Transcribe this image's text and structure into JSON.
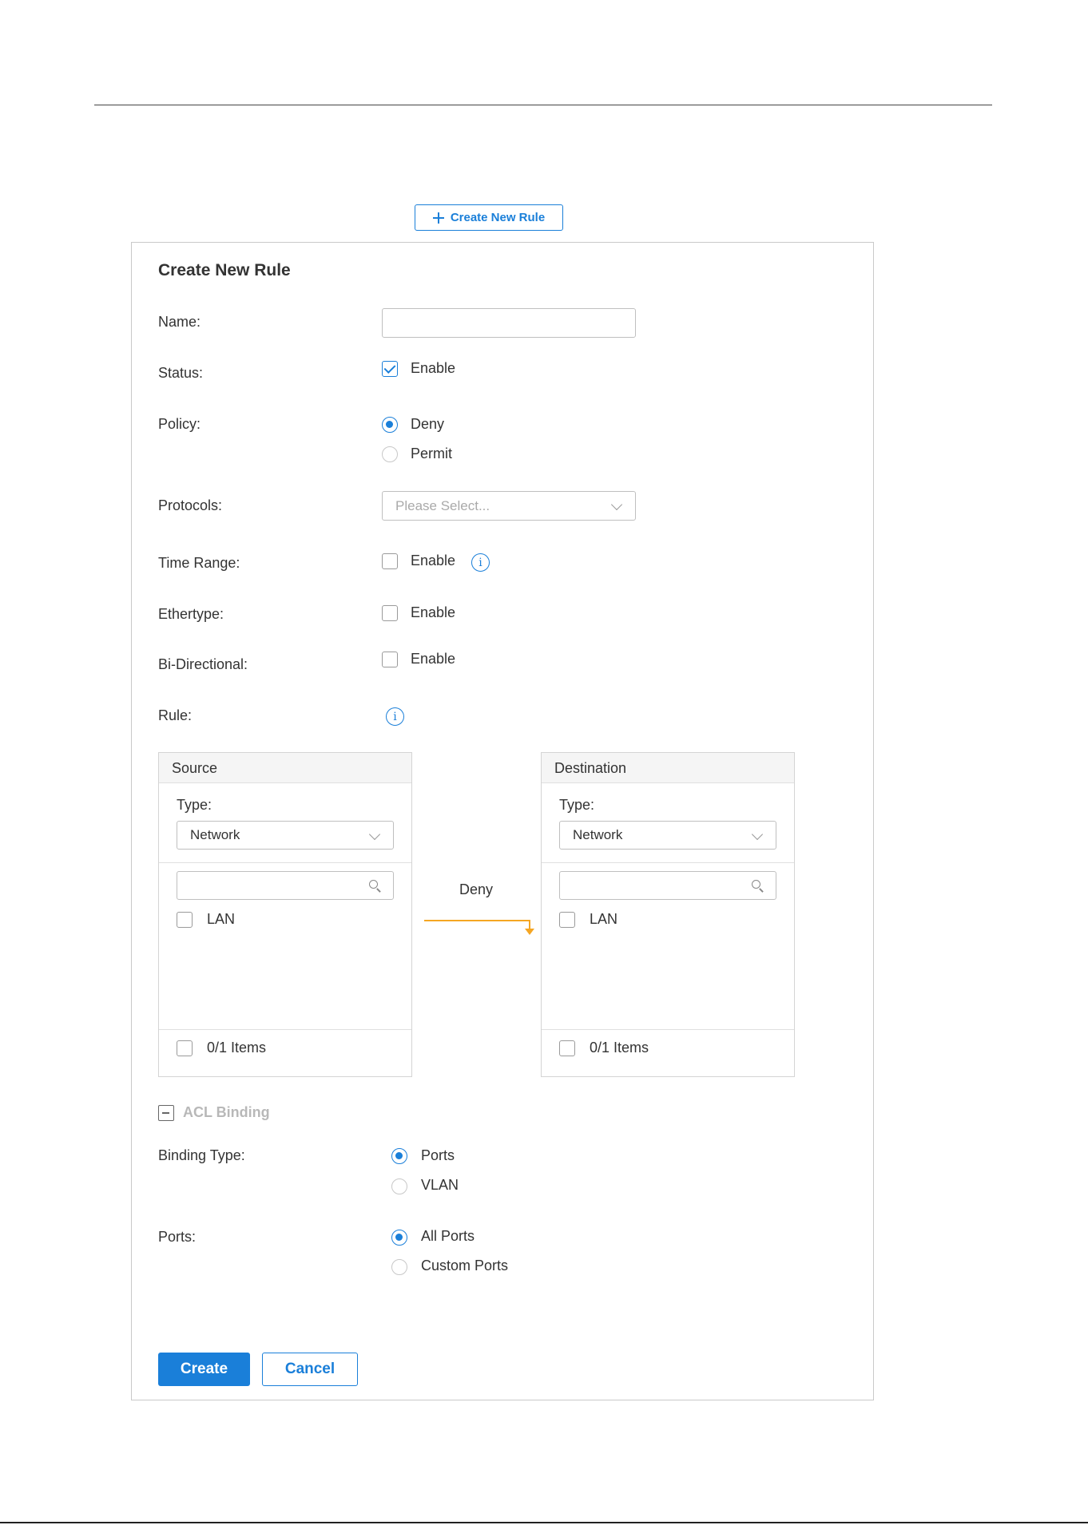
{
  "toolbar": {
    "create_new_rule_label": "Create New Rule"
  },
  "form": {
    "title": "Create New Rule",
    "name": {
      "label": "Name",
      "value": ""
    },
    "status": {
      "label": "Status",
      "option": "Enable",
      "checked": true
    },
    "policy": {
      "label": "Policy",
      "options": [
        "Deny",
        "Permit"
      ],
      "selected": "Deny"
    },
    "protocols": {
      "label": "Protocols",
      "placeholder": "Please Select..."
    },
    "time_range": {
      "label": "Time Range",
      "option": "Enable",
      "checked": false
    },
    "ethertype": {
      "label": "Ethertype",
      "option": "Enable",
      "checked": false
    },
    "bi_directional": {
      "label": "Bi-Directional",
      "option": "Enable",
      "checked": false
    },
    "rule": {
      "label": "Rule"
    }
  },
  "rule_transfer": {
    "source": {
      "title": "Source",
      "type_label": "Type",
      "type_value": "Network",
      "items": [
        {
          "label": "LAN",
          "checked": false
        }
      ],
      "footer": "0/1 Items"
    },
    "action": "Deny",
    "destination": {
      "title": "Destination",
      "type_label": "Type",
      "type_value": "Network",
      "items": [
        {
          "label": "LAN",
          "checked": false
        }
      ],
      "footer": "0/1 Items"
    }
  },
  "acl_binding": {
    "title": "ACL Binding",
    "binding_type": {
      "label": "Binding Type",
      "options": [
        "Ports",
        "VLAN"
      ],
      "selected": "Ports"
    },
    "ports": {
      "label": "Ports",
      "options": [
        "All Ports",
        "Custom Ports"
      ],
      "selected": "All Ports"
    }
  },
  "actions": {
    "create": "Create",
    "cancel": "Cancel"
  },
  "colors": {
    "accent": "#1a7fd9",
    "flow_arrow": "#f5a623"
  }
}
